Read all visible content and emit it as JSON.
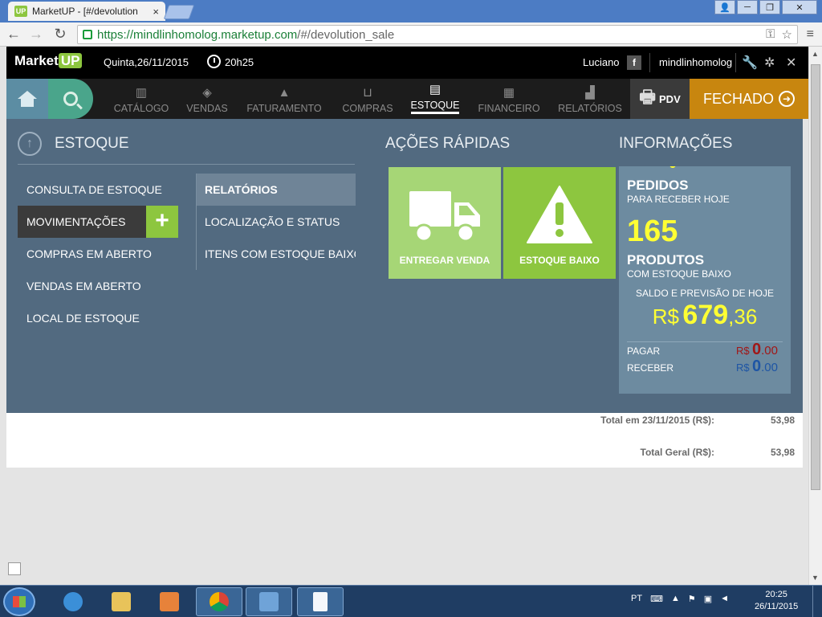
{
  "browser": {
    "tab_title": "MarketUP - [#/devolution",
    "tab_favicon": "UP",
    "url_host": "https://mindlinhomolog.marketup.com",
    "url_path": "/#/devolution_sale",
    "tab_close": "×",
    "window_controls": [
      "👤",
      "─",
      "❐",
      "✕"
    ]
  },
  "appbar": {
    "logo_text": "Market",
    "logo_up": "UP",
    "date": "Quinta,26/11/2015",
    "time": "20h25",
    "user": "Luciano",
    "facebook": "f",
    "store": "mindlinhomolog"
  },
  "nav": {
    "items": [
      {
        "label": "CATÁLOGO",
        "icon": "barcode-icon",
        "glyph": "▥"
      },
      {
        "label": "VENDAS",
        "icon": "tag-icon",
        "glyph": "◈"
      },
      {
        "label": "FATURAMENTO",
        "icon": "money-bag-icon",
        "glyph": "▲"
      },
      {
        "label": "COMPRAS",
        "icon": "basket-icon",
        "glyph": "⊔"
      },
      {
        "label": "ESTOQUE",
        "icon": "box-icon",
        "glyph": "▤"
      },
      {
        "label": "FINANCEIRO",
        "icon": "calculator-icon",
        "glyph": "▦"
      },
      {
        "label": "RELATÓRIOS",
        "icon": "bar-chart-icon",
        "glyph": "▟"
      }
    ],
    "active": "ESTOQUE",
    "pdv": "PDV",
    "status": "FECHADO"
  },
  "panel": {
    "title": "ESTOQUE",
    "menu": [
      "CONSULTA DE ESTOQUE",
      "MOVIMENTAÇÕES",
      "COMPRAS EM ABERTO",
      "VENDAS EM ABERTO",
      "LOCAL DE ESTOQUE"
    ],
    "plus": "+",
    "submenu_header": "RELATÓRIOS",
    "submenu": [
      "LOCALIZAÇÃO E STATUS",
      "ITENS COM ESTOQUE BAIXO"
    ]
  },
  "quick": {
    "title": "AÇÕES RÁPIDAS",
    "tiles": [
      "ENTREGAR VENDA",
      "ESTOQUE BAIXO"
    ]
  },
  "info": {
    "title": "INFORMAÇÕES",
    "pedidos_label": "PEDIDOS",
    "pedidos_sub": "PARA RECEBER HOJE",
    "produtos_count": "165",
    "produtos_label": "PRODUTOS",
    "produtos_sub": "COM ESTOQUE BAIXO",
    "saldo_label": "SALDO E PREVISÃO DE HOJE",
    "saldo_currency": "R$",
    "saldo_int": "679",
    "saldo_dec": ",36",
    "pagar_label": "PAGAR",
    "pagar_currency": "R$",
    "pagar_int": "0",
    "pagar_dec": ".00",
    "receber_label": "RECEBER",
    "receber_currency": "R$",
    "receber_int": "0",
    "receber_dec": ".00"
  },
  "totals": {
    "date_label": "Total em 23/11/2015 (R$):",
    "date_value": "53,98",
    "geral_label": "Total Geral (R$):",
    "geral_value": "53,98"
  },
  "taskbar": {
    "lang": "PT",
    "time": "20:25",
    "date": "26/11/2015"
  },
  "colors": {
    "panel_bg": "#526a80",
    "accent_green": "#8dc63f",
    "status_orange": "#c8860f",
    "highlight_yellow": "#ffff33"
  }
}
